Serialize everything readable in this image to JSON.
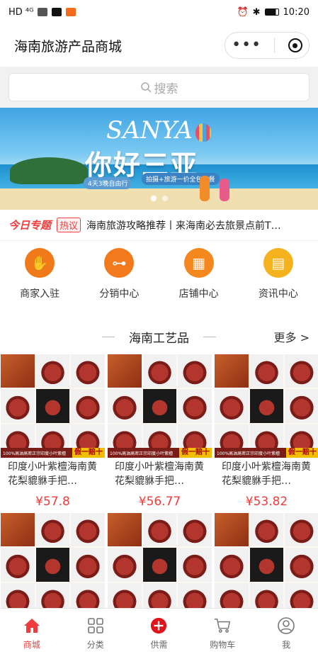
{
  "status": {
    "time": "10:20",
    "left_text": "HD ⁴ᴳ"
  },
  "nav": {
    "title": "海南旅游产品商城"
  },
  "search": {
    "placeholder": "搜索"
  },
  "banner": {
    "hello": "SANYA",
    "cn": "你好三亚",
    "sub1": "4天3晚自由行",
    "sub2": "拍摄+旅游一价全包套餐"
  },
  "news": {
    "logo": "今日专题",
    "tag": "热议",
    "text": "海南旅游攻略推荐丨来海南必去旅景点前T…"
  },
  "quick": [
    {
      "label": "商家入驻",
      "icon": "handshake-icon",
      "color": "#f07a1a"
    },
    {
      "label": "分销中心",
      "icon": "network-icon",
      "color": "#f37a1c"
    },
    {
      "label": "店铺中心",
      "icon": "store-icon",
      "color": "#f4881e"
    },
    {
      "label": "资讯中心",
      "icon": "document-icon",
      "color": "#f5b21f"
    }
  ],
  "section": {
    "title": "海南工艺品",
    "more": "更多 >"
  },
  "products": [
    {
      "title": "印度小叶紫檀海南黄花梨貔貅手把…",
      "price": "¥57.8",
      "strip_left": "100%高油高密正宗印度小叶紫檀",
      "strip_right": "假一赔十"
    },
    {
      "title": "印度小叶紫檀海南黄花梨貔貅手把…",
      "price": "¥56.77",
      "strip_left": "100%高油高密正宗印度小叶紫檀",
      "strip_right": "假一赔十"
    },
    {
      "title": "印度小叶紫檀海南黄花梨貔貅手把…",
      "price": "¥53.82",
      "strip_left": "100%高油高密正宗印度小叶紫檀",
      "strip_right": "假一赔十"
    }
  ],
  "tabs": [
    {
      "label": "商城",
      "icon": "home-icon",
      "active": true
    },
    {
      "label": "分类",
      "icon": "grid-icon",
      "active": false
    },
    {
      "label": "供需",
      "icon": "plus-circle-icon",
      "active": false
    },
    {
      "label": "购物车",
      "icon": "cart-icon",
      "active": false
    },
    {
      "label": "我",
      "icon": "user-icon",
      "active": false
    }
  ],
  "colors": {
    "accent": "#f03c3c"
  }
}
